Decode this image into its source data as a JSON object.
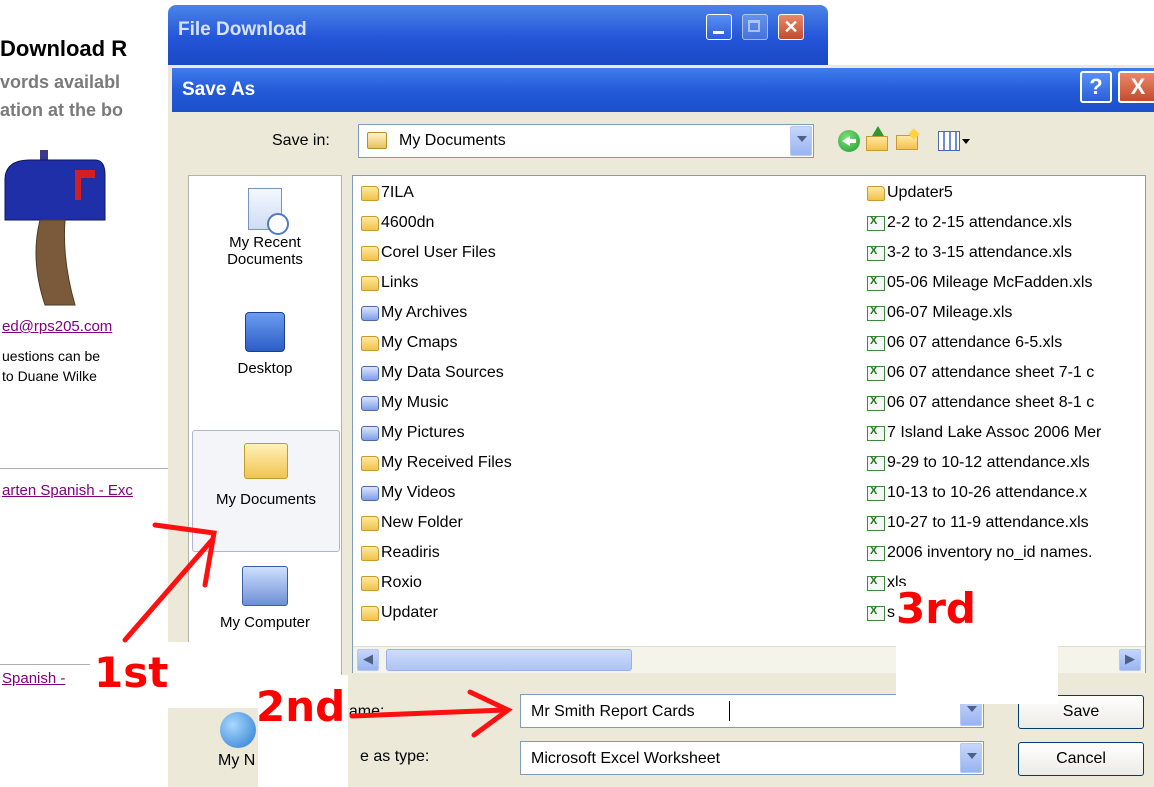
{
  "background_page": {
    "title": "Download R",
    "line1": "vords availabl",
    "line2": "ation at the bo",
    "email_link": "ed@rps205.com",
    "question_line1": "uestions can be",
    "question_line2": "to Duane Wilke",
    "link_spanish_exc": "arten Spanish - Exc",
    "link_spanish": "Spanish -"
  },
  "file_download_window": {
    "title": "File Download"
  },
  "save_as_dialog": {
    "title": "Save As",
    "help_label": "?",
    "close_label": "X",
    "save_in_label": "Save in:",
    "save_in_value": "My Documents"
  },
  "places": [
    {
      "label": "My Recent Documents",
      "icon": "recent-documents-icon"
    },
    {
      "label": "Desktop",
      "icon": "desktop-icon"
    },
    {
      "label": "My Documents",
      "icon": "my-documents-icon",
      "selected": true
    },
    {
      "label": "My Computer",
      "icon": "my-computer-icon"
    },
    {
      "label": "My N",
      "icon": "network-places-icon"
    }
  ],
  "files_col1": [
    {
      "name": "7ILA",
      "type": "folder"
    },
    {
      "name": "4600dn",
      "type": "folder"
    },
    {
      "name": "Corel User Files",
      "type": "folder"
    },
    {
      "name": "Links",
      "type": "folder"
    },
    {
      "name": "My Archives",
      "type": "special"
    },
    {
      "name": "My Cmaps",
      "type": "folder"
    },
    {
      "name": "My Data Sources",
      "type": "special"
    },
    {
      "name": "My Music",
      "type": "special"
    },
    {
      "name": "My Pictures",
      "type": "special"
    },
    {
      "name": "My Received Files",
      "type": "folder"
    },
    {
      "name": "My Videos",
      "type": "special"
    },
    {
      "name": "New Folder",
      "type": "folder"
    },
    {
      "name": "Readiris",
      "type": "folder"
    },
    {
      "name": "Roxio",
      "type": "folder"
    },
    {
      "name": "Updater",
      "type": "folder"
    }
  ],
  "files_col2": [
    {
      "name": "Updater5",
      "type": "folder"
    },
    {
      "name": "2-2 to 2-15 attendance.xls",
      "type": "xls"
    },
    {
      "name": "3-2 to 3-15 attendance.xls",
      "type": "xls"
    },
    {
      "name": "05-06 Mileage McFadden.xls",
      "type": "xls"
    },
    {
      "name": "06-07 Mileage.xls",
      "type": "xls"
    },
    {
      "name": "06 07 attendance 6-5.xls",
      "type": "xls"
    },
    {
      "name": "06 07 attendance sheet 7-1 c",
      "type": "xls"
    },
    {
      "name": "06 07 attendance sheet 8-1 c",
      "type": "xls"
    },
    {
      "name": "7 Island Lake Assoc 2006 Mer",
      "type": "xls"
    },
    {
      "name": "9-29 to 10-12 attendance.xls",
      "type": "xls"
    },
    {
      "name": "10-13 to 10-26 attendance.x",
      "type": "xls"
    },
    {
      "name": "10-27 to 11-9 attendance.xls",
      "type": "xls"
    },
    {
      "name": "2006 inventory no_id names.",
      "type": "xls"
    },
    {
      "name": "xls",
      "type": "xls"
    },
    {
      "name": "s",
      "type": "xls"
    }
  ],
  "file_name": {
    "label_fragment": "name:",
    "value": "Mr Smith Report Cards"
  },
  "save_as_type": {
    "label_fragment": "e as type:",
    "value": "Microsoft Excel Worksheet"
  },
  "buttons": {
    "save": "Save",
    "cancel": "Cancel"
  },
  "annotations": {
    "first": "1st",
    "second": "2nd",
    "third": "3rd",
    "color": "#ff0000"
  }
}
